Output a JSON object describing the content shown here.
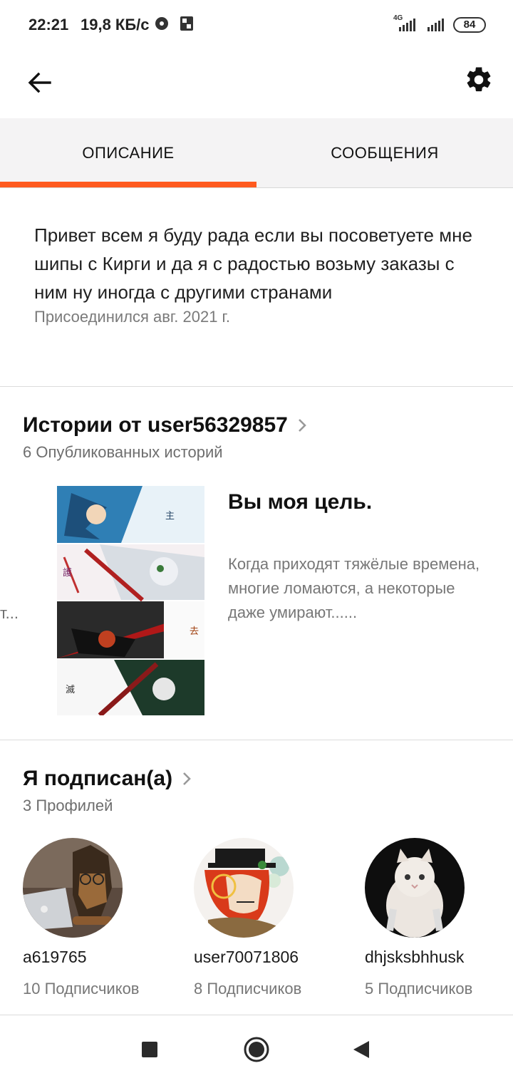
{
  "status_bar": {
    "time": "22:21",
    "speed": "19,8 КБ/с",
    "network": "4G",
    "battery": "84"
  },
  "toolbar": {
    "back_icon": "arrow-left-icon",
    "settings_icon": "gear-icon"
  },
  "tabs": [
    {
      "label": "ОПИСАНИЕ",
      "active": true
    },
    {
      "label": "СООБЩЕНИЯ",
      "active": false
    }
  ],
  "accent_color": "#ff5a1f",
  "description": {
    "text": "Привет всем я буду рада если вы посоветуете мне шипы с Кирги и да я с радостью возьму заказы с ним ну иногда с другими странами",
    "joined": "Присоединился авг. 2021 г."
  },
  "stories": {
    "title": "Истории от user56329857",
    "subtitle": "6 Опубликованных историй",
    "peek_text": "т...",
    "items": [
      {
        "title": "Вы моя цель.",
        "blurb": "Когда приходят тяжёлые времена, многие ломаются, а некоторые даже умирают......"
      }
    ]
  },
  "following": {
    "title": "Я подписан(а)",
    "subtitle": "3 Профилей",
    "profiles": [
      {
        "name": "a619765",
        "followers": "10 Подписчиков"
      },
      {
        "name": "user70071806",
        "followers": "8 Подписчиков"
      },
      {
        "name": "dhjsksbhhusk",
        "followers": "5 Подписчиков"
      }
    ]
  },
  "navbar": {
    "recents_icon": "square-icon",
    "home_icon": "circle-icon",
    "back_icon": "triangle-back-icon"
  }
}
